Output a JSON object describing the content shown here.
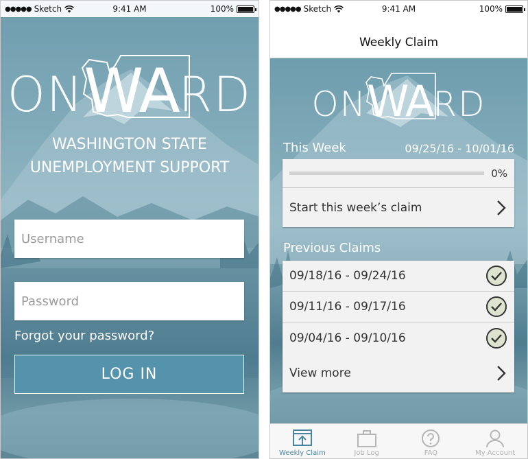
{
  "status_bar": {
    "carrier": "Sketch",
    "time": "9:41 AM",
    "battery": "100%"
  },
  "login_screen": {
    "logo": {
      "left": "ON",
      "center": "WA",
      "right": "RD"
    },
    "subtitle_line1": "WASHINGTON STATE",
    "subtitle_line2": "UNEMPLOYMENT SUPPORT",
    "username_placeholder": "Username",
    "password_placeholder": "Password",
    "forgot_link": "Forgot your password?",
    "login_button": "LOG IN"
  },
  "claim_screen": {
    "nav_title": "Weekly Claim",
    "logo": {
      "left": "ON",
      "center": "WA",
      "right": "RD"
    },
    "this_week_label": "This Week",
    "this_week_range": "09/25/16 - 10/01/16",
    "progress_value": 0,
    "progress_text": "0%",
    "start_claim": "Start this week’s claim",
    "previous_label": "Previous Claims",
    "previous_claims": [
      "09/18/16 - 09/24/16",
      "09/11/16 - 09/17/16",
      "09/04/16 - 09/10/16"
    ],
    "view_more": "View more",
    "tabs": [
      {
        "label": "Weekly Claim",
        "icon": "weekly-claim-icon",
        "active": true
      },
      {
        "label": "Job Log",
        "icon": "briefcase-icon",
        "active": false
      },
      {
        "label": "FAQ",
        "icon": "question-icon",
        "active": false
      },
      {
        "label": "My Account",
        "icon": "person-icon",
        "active": false
      }
    ]
  },
  "colors": {
    "accent": "#5592ac",
    "active_tab": "#4a86a4",
    "check_fill": "#dde3cf"
  }
}
